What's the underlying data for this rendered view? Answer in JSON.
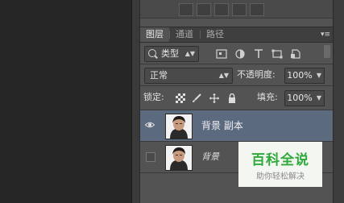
{
  "panel": {
    "tabs": [
      {
        "label": "图层",
        "active": true
      },
      {
        "label": "通道",
        "active": false
      },
      {
        "label": "路径",
        "active": false
      }
    ],
    "menu_icon": "panel-menu-icon"
  },
  "filter": {
    "kind_label": "类型",
    "icons": [
      "pixel-filter-icon",
      "adjustment-filter-icon",
      "type-filter-icon",
      "shape-filter-icon",
      "smart-object-filter-icon"
    ]
  },
  "blend": {
    "mode": "正常",
    "opacity_label": "不透明度:",
    "opacity_value": "100%"
  },
  "lock": {
    "label": "锁定:",
    "icons": [
      "lock-transparent-icon",
      "lock-paint-icon",
      "lock-move-icon",
      "lock-all-icon"
    ],
    "fill_label": "填充:",
    "fill_value": "100%"
  },
  "layers": [
    {
      "name": "背景 副本",
      "visible": true,
      "selected": true
    },
    {
      "name": "背景",
      "visible": false,
      "selected": false
    }
  ],
  "watermark": {
    "title": "百科全说",
    "subtitle": "助你轻松解决"
  },
  "colors": {
    "panel_bg": "#535353",
    "selected_layer": "#5c6a80",
    "watermark_green": "#2eaa3a"
  }
}
